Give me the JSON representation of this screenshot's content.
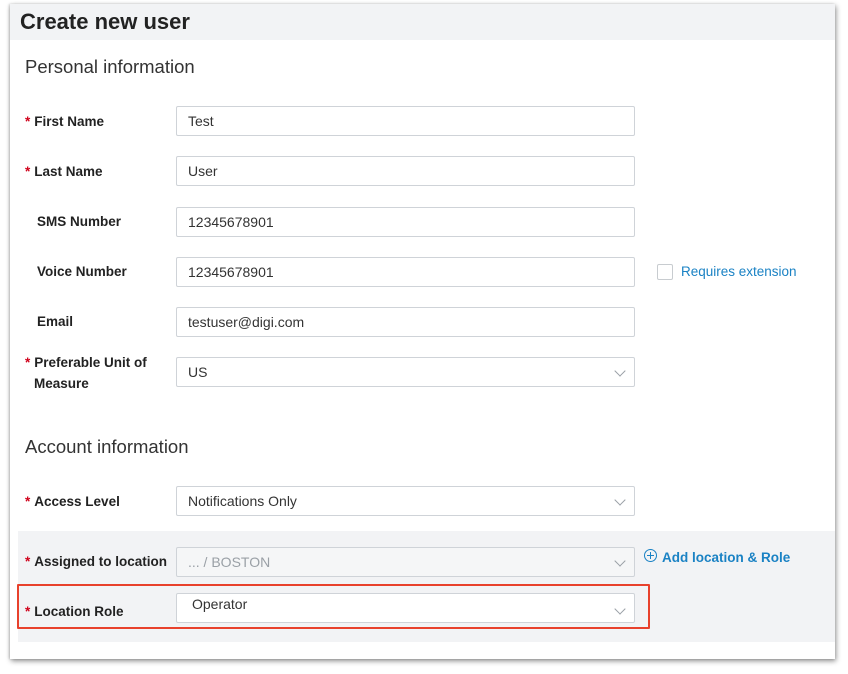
{
  "title": "Create new user",
  "personal": {
    "heading": "Personal information",
    "first_name": {
      "label": "First Name",
      "value": "Test"
    },
    "last_name": {
      "label": "Last Name",
      "value": "User"
    },
    "sms": {
      "label": "SMS Number",
      "value": "12345678901"
    },
    "voice": {
      "label": "Voice Number",
      "value": "12345678901",
      "extension_label": "Requires extension"
    },
    "email": {
      "label": "Email",
      "value": "testuser@digi.com"
    },
    "unit": {
      "label_line1": "Preferable Unit of",
      "label_line2": "Measure",
      "value": "US"
    }
  },
  "account": {
    "heading": "Account information",
    "access_level": {
      "label": "Access Level",
      "value": "Notifications Only"
    },
    "location": {
      "label": "Assigned to location",
      "value": "... / BOSTON",
      "add_link": "Add location & Role"
    },
    "role": {
      "label": "Location Role",
      "value": "Operator"
    }
  },
  "colors": {
    "required": "#d0021b",
    "link": "#1a82c4",
    "highlight": "#e8412c"
  },
  "icons": [
    "chevron-down-icon",
    "plus-circle-icon",
    "checkbox-icon"
  ]
}
